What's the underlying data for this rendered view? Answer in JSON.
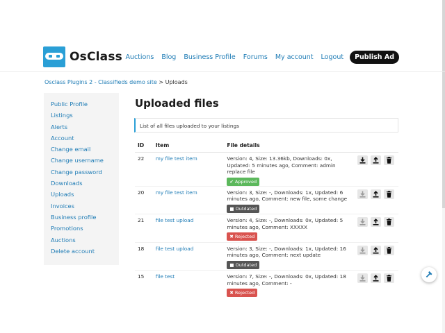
{
  "header": {
    "logo_text": "OsClass",
    "nav": [
      "Auctions",
      "Blog",
      "Business Profile",
      "Forums",
      "My account",
      "Logout"
    ],
    "publish_label": "Publish Ad"
  },
  "breadcrumb": {
    "link": "Osclass Plugins 2 - Classifieds demo site",
    "separator": ">",
    "current": "Uploads"
  },
  "sidebar": {
    "items": [
      "Public Profile",
      "Listings",
      "Alerts",
      "Account",
      "Change email",
      "Change username",
      "Change password",
      "Downloads",
      "Uploads",
      "Invoices",
      "Business profile",
      "Promotions",
      "Auctions",
      "Delete account"
    ]
  },
  "main": {
    "title": "Uploaded files",
    "info": "List of all files uploaded to your listings",
    "columns": [
      "ID",
      "Item",
      "File details"
    ],
    "rows": [
      {
        "id": "22",
        "item": "my file test item",
        "details": "Version: 4, Size: 13.36kb, Downloads: 0x, Updated: 5 minutes ago, Comment: admin replace file",
        "status": "Approved",
        "status_icon": "check-icon",
        "download_enabled": true
      },
      {
        "id": "20",
        "item": "my file test item",
        "details": "Version: 3, Size: -, Downloads: 1x, Updated: 6 minutes ago, Comment: new file, some change",
        "status": "Outdated",
        "status_icon": "file-icon",
        "download_enabled": false
      },
      {
        "id": "21",
        "item": "file test upload",
        "details": "Version: 4, Size: -, Downloads: 0x, Updated: 5 minutes ago, Comment: XXXXX",
        "status": "Rejected",
        "status_icon": "x-icon",
        "download_enabled": false
      },
      {
        "id": "18",
        "item": "file test upload",
        "details": "Version: 3, Size: -, Downloads: 1x, Updated: 16 minutes ago, Comment: next update",
        "status": "Outdated",
        "status_icon": "file-icon",
        "download_enabled": false
      },
      {
        "id": "15",
        "item": "file test",
        "details": "Version: 7, Size: -, Downloads: 0x, Updated: 18 minutes ago, Comment: -",
        "status": "Rejected",
        "status_icon": "x-icon",
        "download_enabled": false
      }
    ]
  },
  "colors": {
    "accent": "#1d7bb5",
    "brand": "#2a9fd6",
    "approved": "#5cb85c",
    "outdated": "#555555",
    "rejected": "#d9534f"
  },
  "icons": [
    "download-icon",
    "upload-icon",
    "trash-icon",
    "hammer-icon"
  ]
}
